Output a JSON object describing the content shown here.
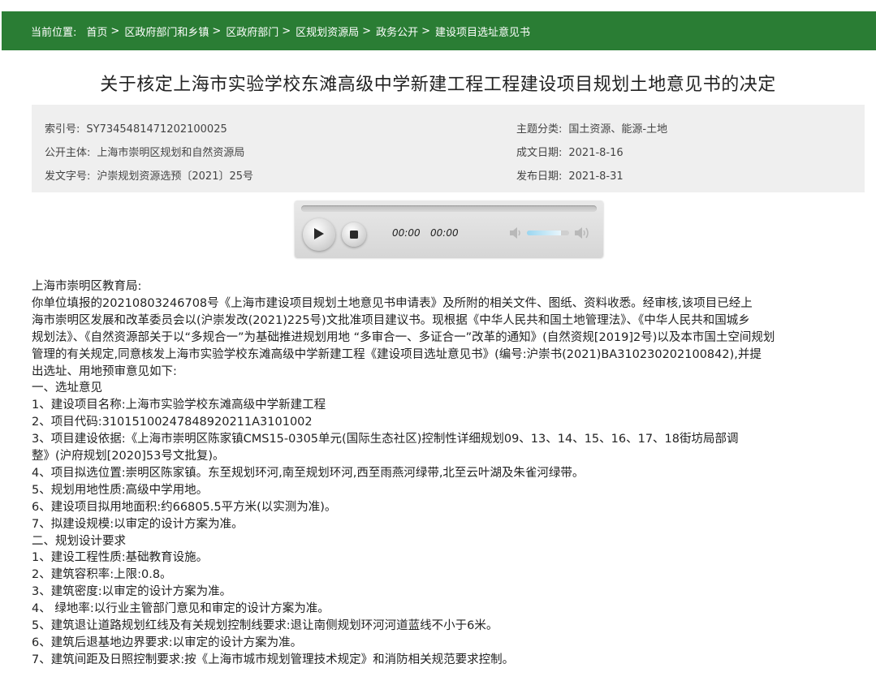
{
  "breadcrumb": {
    "label": "当前位置:",
    "items": [
      "首页",
      "区政府部门和乡镇",
      "区政府部门",
      "区规划资源局",
      "政务公开",
      "建设项目选址意见书"
    ],
    "separator": ">"
  },
  "title": "关于核定上海市实验学校东滩高级中学新建工程工程建设项目规划土地意见书的决定",
  "meta": {
    "index_no": {
      "k": "索引号:",
      "v": "SY7345481471202100025"
    },
    "publisher": {
      "k": "公开主体:",
      "v": "上海市崇明区规划和自然资源局"
    },
    "doc_no": {
      "k": "发文字号:",
      "v": "沪崇规划资源选预〔2021〕25号"
    },
    "category": {
      "k": "主题分类:",
      "v": "国土资源、能源-土地"
    },
    "created": {
      "k": "成文日期:",
      "v": "2021-8-16"
    },
    "published": {
      "k": "发布日期:",
      "v": "2021-8-31"
    }
  },
  "player": {
    "current_time": "00:00",
    "duration": "00:00",
    "progress": 0,
    "volume": 0.8
  },
  "body": {
    "lines": [
      "上海市崇明区教育局:",
      "    你单位填报的20210803246708号《上海市建设项目规划土地意见书申请表》及所附的相关文件、图纸、资料收悉。经审核,该项目已经上",
      "海市崇明区发展和改革委员会以(沪崇发改(2021)225号)文批准项目建议书。现根据《中华人民共和国土地管理法》、《中华人民共和国城乡",
      "规划法》、《自然资源部关于以“多规合一”为基础推进规划用地 “多审合一、多证合一”改革的通知》(自然资规[2019]2号)以及本市国土空间规划",
      "管理的有关规定,同意核发上海市实验学校东滩高级中学新建工程《建设项目选址意见书》(编号:沪崇书(2021)BA310230202100842),并提",
      "出选址、用地预审意见如下:",
      "    一、选址意见",
      "    1、建设项目名称:上海市实验学校东滩高级中学新建工程",
      "    2、项目代码:31015100247848920211A3101002",
      "    3、项目建设依据:《上海市崇明区陈家镇CMS15-0305单元(国际生态社区)控制性详细规划09、13、14、15、16、17、18街坊局部调",
      "整》(沪府规划[2020]53号文批复)。",
      "    4、项目拟选位置:崇明区陈家镇。东至规划环河,南至规划环河,西至雨燕河绿带,北至云叶湖及朱雀河绿带。",
      "    5、规划用地性质:高级中学用地。",
      "    6、建设项目拟用地面积:约66805.5平方米(以实测为准)。",
      "    7、拟建设规模:以审定的设计方案为准。",
      "    二、规划设计要求",
      "    1、建设工程性质:基础教育设施。",
      "    2、建筑容积率:上限:0.8。",
      "    3、建筑密度:以审定的设计方案为准。",
      "    4、 绿地率:以行业主管部门意见和审定的设计方案为准。",
      "    5、建筑退让道路规划红线及有关规划控制线要求:退让南侧规划环河河道蓝线不小于6米。",
      "    6、建筑后退基地边界要求:以审定的设计方案为准。",
      "    7、建筑间距及日照控制要求:按《上海市城市规划管理技术规定》和消防相关规范要求控制。"
    ]
  },
  "colors": {
    "header_green": "#2a7d34",
    "meta_bg": "#efefef"
  }
}
